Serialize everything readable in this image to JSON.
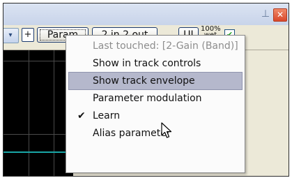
{
  "window": {
    "pin_icon": "pin-icon",
    "close_icon": "close-icon",
    "close_glyph": "✕",
    "pin_glyph": "⊥"
  },
  "toolbar": {
    "dropdown_glyph": "▾",
    "add_label": "+",
    "param_label": "Param",
    "io_label": "2 in 2 out",
    "ui_label": "UI",
    "wet_percent": "100%",
    "wet_label": "wet",
    "wet_checked": true,
    "check_glyph": "✔"
  },
  "menu": {
    "items": [
      {
        "label": "Last touched: [2-Gain (Band)]",
        "enabled": false,
        "checked": false,
        "highlighted": false
      },
      {
        "label": "Show in track controls",
        "enabled": true,
        "checked": false,
        "highlighted": false
      },
      {
        "label": "Show track envelope",
        "enabled": true,
        "checked": false,
        "highlighted": true
      },
      {
        "label": "Parameter modulation",
        "enabled": true,
        "checked": false,
        "highlighted": false
      },
      {
        "label": "Learn",
        "enabled": true,
        "checked": true,
        "highlighted": false
      },
      {
        "label": "Alias parameter",
        "enabled": true,
        "checked": false,
        "highlighted": false
      }
    ],
    "checkmark_glyph": "✔"
  },
  "colors": {
    "highlight": "#b5b8cc",
    "envelope_line": "#19a6a6",
    "close_button": "#d9472b"
  }
}
